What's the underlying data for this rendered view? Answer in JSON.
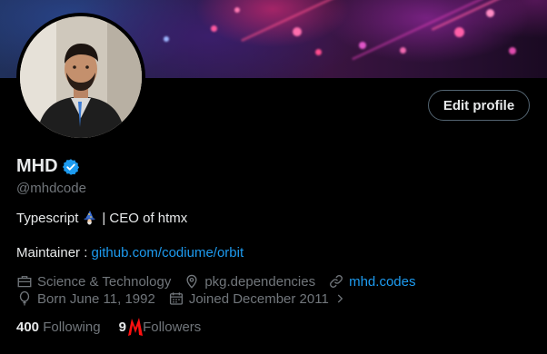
{
  "profile": {
    "name": "MHD",
    "handle": "@mhdcode",
    "bio_line1_prefix": "Typescript",
    "bio_line1_suffix": "| CEO of htmx",
    "maintainer_label": "Maintainer :",
    "maintainer_link": "github.com/codiume/orbit"
  },
  "actions": {
    "edit_profile": "Edit profile"
  },
  "meta": {
    "category": "Science & Technology",
    "location": "pkg.dependencies",
    "website": "mhd.codes",
    "born": "Born June 11, 1992",
    "joined": "Joined December 2011"
  },
  "stats": {
    "following_count": "400",
    "following_label": "Following",
    "followers_count": "9",
    "followers_label": "Followers"
  },
  "colors": {
    "accent": "#1d9bf0",
    "muted": "#71767b",
    "text": "#e7e9ea",
    "background": "#000000"
  }
}
